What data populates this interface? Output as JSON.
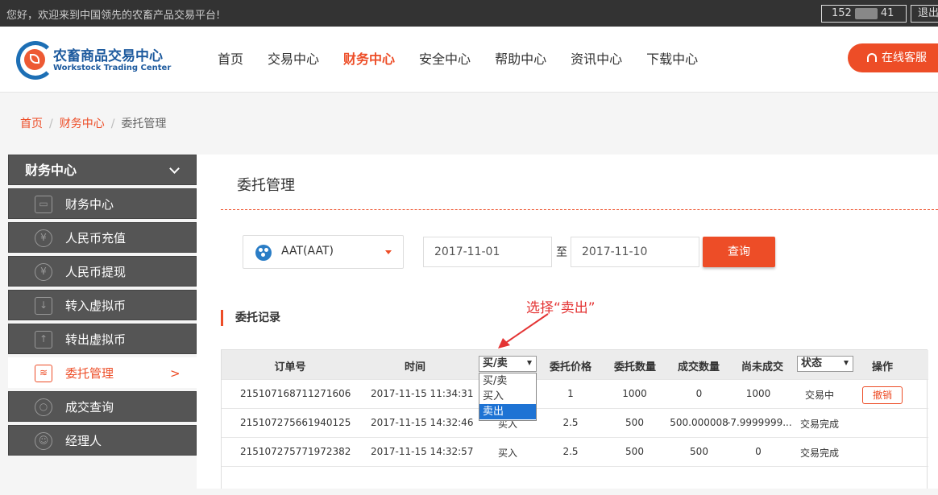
{
  "topbar": {
    "welcome": "您好，欢迎来到中国领先的农畜产品交易平台!",
    "account_prefix": "152",
    "account_suffix": "41",
    "logout": "退出"
  },
  "logo": {
    "cn": "农畜商品交易中心",
    "en": "Workstock Trading Center"
  },
  "nav": {
    "items": [
      "首页",
      "交易中心",
      "财务中心",
      "安全中心",
      "帮助中心",
      "资讯中心",
      "下载中心"
    ],
    "active": "财务中心"
  },
  "service_button": "在线客服",
  "breadcrumb": [
    "首页",
    "财务中心",
    "委托管理"
  ],
  "sidebar": {
    "title": "财务中心",
    "items": [
      {
        "label": "财务中心",
        "icon": "wallet-icon"
      },
      {
        "label": "人民币充值",
        "icon": "yuan-in-icon"
      },
      {
        "label": "人民币提现",
        "icon": "yuan-out-icon"
      },
      {
        "label": "转入虚拟币",
        "icon": "download-icon"
      },
      {
        "label": "转出虚拟币",
        "icon": "upload-icon"
      },
      {
        "label": "委托管理",
        "icon": "order-icon",
        "arrow": ">"
      },
      {
        "label": "成交查询",
        "icon": "search-icon"
      },
      {
        "label": "经理人",
        "icon": "badge-icon"
      }
    ],
    "active": "委托管理"
  },
  "main": {
    "title": "委托管理",
    "coin": "AAT(AAT)",
    "date_from": "2017-11-01",
    "date_sep": "至",
    "date_to": "2017-11-10",
    "query": "查询",
    "annotation": "选择“卖出”",
    "section": "委托记录"
  },
  "table": {
    "headers": [
      "订单号",
      "时间",
      "买/卖",
      "委托价格",
      "委托数量",
      "成交数量",
      "尚未成交",
      "状态",
      "操作"
    ],
    "type_filter": {
      "value": "买/卖",
      "options": [
        "买/卖",
        "买入",
        "卖出"
      ],
      "highlighted": "卖出"
    },
    "status_filter": "状态",
    "rows": [
      {
        "id": "215107168711271606",
        "time": "2017-11-15 11:34:31",
        "side": "",
        "price": "1",
        "qty": "1000",
        "filled": "0",
        "remaining": "1000",
        "status": "交易中",
        "action": "撤销"
      },
      {
        "id": "215107275661940125",
        "time": "2017-11-15 14:32:46",
        "side": "买入",
        "price": "2.5",
        "qty": "500",
        "filled": "500.000008",
        "remaining": "-7.9999999...",
        "status": "交易完成",
        "action": ""
      },
      {
        "id": "215107275771972382",
        "time": "2017-11-15 14:32:57",
        "side": "买入",
        "price": "2.5",
        "qty": "500",
        "filled": "500",
        "remaining": "0",
        "status": "交易完成",
        "action": ""
      }
    ]
  },
  "colors": {
    "accent": "#ed4d27",
    "sidebar": "#555555",
    "highlight": "#1e73d4",
    "annotation": "#e43434"
  }
}
